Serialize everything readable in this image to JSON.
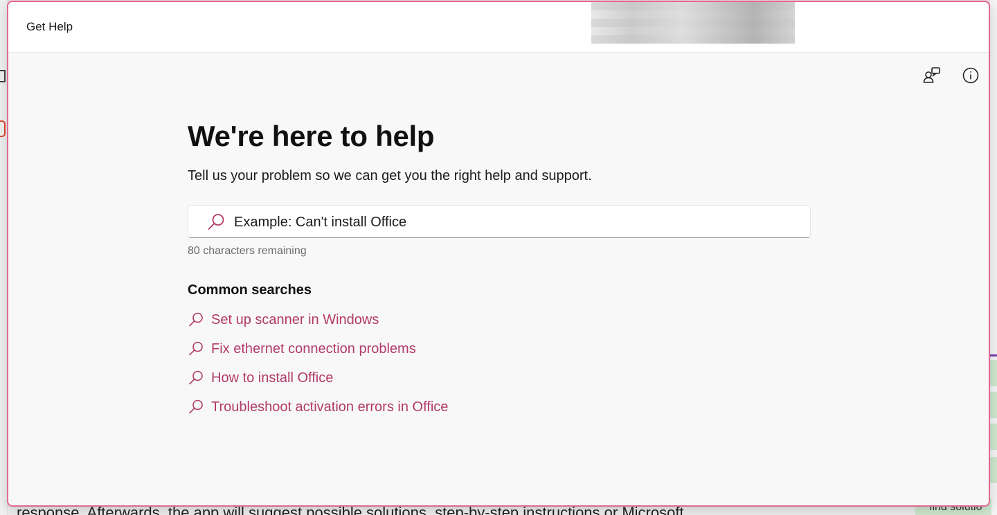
{
  "background": {
    "bottom_text": "response. Afterwards, the app will suggest possible solutions, step-by-step instructions or Microsoft",
    "bottom_right_chip": "find solutio"
  },
  "window": {
    "title": "Get Help",
    "border_color": "#e16a92",
    "accent_color": "#b23a68"
  },
  "toolbar": {
    "contact_icon": "contact-support-icon",
    "info_icon": "info-icon"
  },
  "main": {
    "headline": "We're here to help",
    "subtitle": "Tell us your problem so we can get you the right help and support.",
    "search": {
      "placeholder": "Example: Can't install Office",
      "value": "",
      "chars_remaining": "80 characters remaining"
    },
    "common_searches": {
      "heading": "Common searches",
      "items": [
        {
          "label": "Set up scanner in Windows"
        },
        {
          "label": "Fix ethernet connection problems"
        },
        {
          "label": "How to install Office"
        },
        {
          "label": "Troubleshoot activation errors in Office"
        }
      ]
    }
  }
}
